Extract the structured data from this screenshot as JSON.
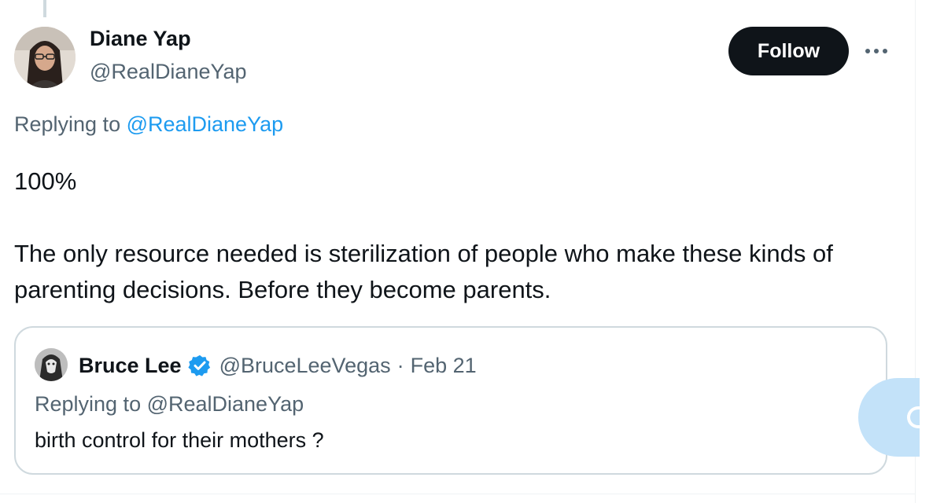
{
  "author": {
    "display_name": "Diane Yap",
    "handle": "@RealDianeYap",
    "avatar_icon": "user-avatar"
  },
  "actions": {
    "follow_label": "Follow",
    "more_icon": "more-horizontal-icon"
  },
  "reply_context": {
    "prefix": "Replying to ",
    "mention": "@RealDianeYap"
  },
  "tweet": {
    "paragraphs": [
      "100%",
      "The only resource needed is sterilization of people who make these kinds of parenting decisions. Before they become parents."
    ]
  },
  "quoted_tweet": {
    "display_name": "Bruce Lee",
    "verified": true,
    "verified_icon": "verified-badge-icon",
    "handle": "@BruceLeeVegas",
    "separator": "·",
    "date": "Feb 21",
    "replying_to": "Replying to @RealDianeYap",
    "text": "birth control for their mothers ?"
  },
  "colors": {
    "text_primary": "#0f1419",
    "text_secondary": "#536471",
    "link": "#1d9bf0",
    "follow_bg": "#0f1419",
    "border": "#cfd9de",
    "floating_button": "#c3e2f9"
  }
}
